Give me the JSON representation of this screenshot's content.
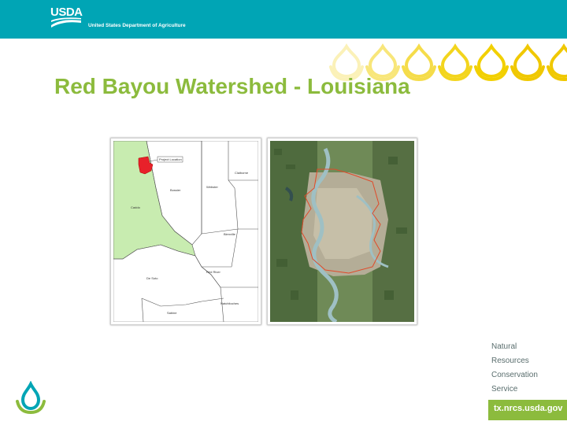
{
  "header": {
    "logo_text": "USDA",
    "department": "United States Department of Agriculture"
  },
  "title": "Red Bayou Watershed - Louisiana",
  "map": {
    "location_label": "Project Location",
    "counties": [
      "Caddo",
      "Bossier",
      "Webster",
      "Claiborne",
      "Bienville",
      "De Soto",
      "Red River",
      "Natchitoches",
      "Sabine"
    ],
    "highlight_color": "#e8212a",
    "caddo_color": "#c8ecb0"
  },
  "footer": {
    "agency_lines": [
      "Natural",
      "Resources",
      "Conservation",
      "Service"
    ],
    "url": "tx.nrcs.usda.gov"
  },
  "colors": {
    "header": "#00a5b5",
    "title": "#8cbb3d",
    "drops": "#f2d000"
  }
}
